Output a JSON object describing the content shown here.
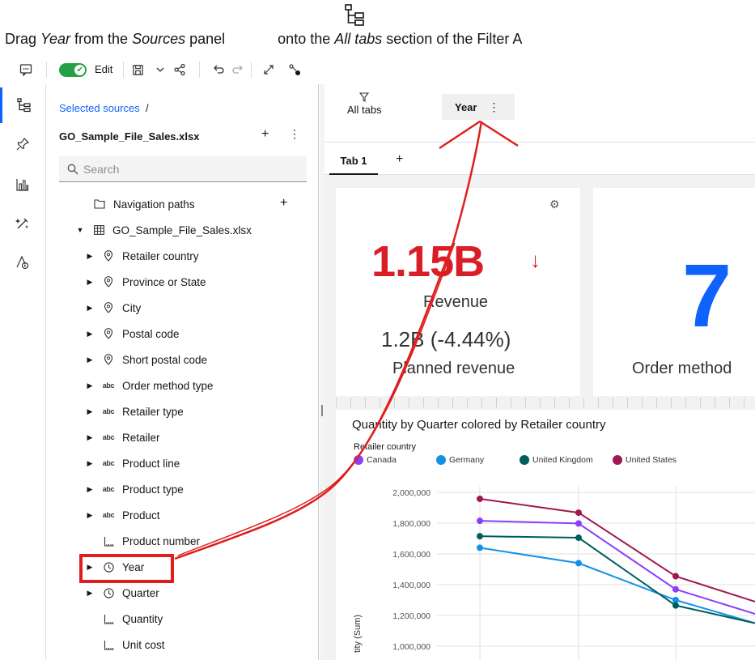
{
  "instruction": {
    "prefix": "Drag ",
    "em1": "Year",
    "mid": " from the ",
    "em2": "Sources",
    "after": " panel",
    "rest": " onto the ",
    "em3": "All tabs",
    "end": " section of the Filter A"
  },
  "toolbar": {
    "edit_label": "Edit",
    "edit_on": true
  },
  "sources": {
    "breadcrumb": "Selected sources",
    "breadcrumb_sep": "/",
    "file_title": "GO_Sample_File_Sales.xlsx",
    "search_placeholder": "Search",
    "navigation_paths": "Navigation paths",
    "file_node": "GO_Sample_File_Sales.xlsx",
    "items": [
      {
        "label": "Retailer country",
        "icon": "location-icon",
        "expandable": true
      },
      {
        "label": "Province or State",
        "icon": "location-icon",
        "expandable": true
      },
      {
        "label": "City",
        "icon": "location-icon",
        "expandable": true
      },
      {
        "label": "Postal code",
        "icon": "location-icon",
        "expandable": true
      },
      {
        "label": "Short postal code",
        "icon": "location-icon",
        "expandable": true
      },
      {
        "label": "Order method type",
        "icon": "text-icon",
        "expandable": true
      },
      {
        "label": "Retailer type",
        "icon": "text-icon",
        "expandable": true
      },
      {
        "label": "Retailer",
        "icon": "text-icon",
        "expandable": true
      },
      {
        "label": "Product line",
        "icon": "text-icon",
        "expandable": true
      },
      {
        "label": "Product type",
        "icon": "text-icon",
        "expandable": true
      },
      {
        "label": "Product",
        "icon": "text-icon",
        "expandable": true
      },
      {
        "label": "Product number",
        "icon": "measure-icon",
        "expandable": false
      },
      {
        "label": "Year",
        "icon": "clock-icon",
        "expandable": true
      },
      {
        "label": "Quarter",
        "icon": "clock-icon",
        "expandable": true
      },
      {
        "label": "Quantity",
        "icon": "measure-icon",
        "expandable": false
      },
      {
        "label": "Unit cost",
        "icon": "measure-icon",
        "expandable": false
      }
    ]
  },
  "filters": {
    "all_tabs_label": "All tabs",
    "chip_label": "Year"
  },
  "tabs": {
    "tab1": "Tab 1",
    "add": "+"
  },
  "kpi1": {
    "value": "1.15B",
    "label": "Revenue",
    "planned": "1.2B (-4.44%)",
    "planned_label": "Planned revenue"
  },
  "kpi2": {
    "value": "7",
    "label": "Order method"
  },
  "chart": {
    "title": "Quantity by Quarter colored by Retailer country",
    "legend_title": "Retailer country",
    "ylabel": "tity (Sum)"
  },
  "chart_data": {
    "type": "line",
    "title": "Quantity by Quarter colored by Retailer country",
    "xlabel": "",
    "ylabel": "Quantity (Sum)",
    "ylim": [
      1000000,
      2000000
    ],
    "yticks": [
      2000000,
      1800000,
      1600000,
      1400000,
      1200000,
      1000000
    ],
    "ytick_labels": [
      "2,000,000",
      "1,800,000",
      "1,600,000",
      "1,400,000",
      "1,200,000",
      "1,000,000"
    ],
    "x": [
      1,
      2,
      3,
      4
    ],
    "legend_position": "top-left",
    "series": [
      {
        "name": "Canada",
        "color": "#8a3ffc",
        "values": [
          1815000,
          1798000,
          1370000,
          1210000
        ]
      },
      {
        "name": "Germany",
        "color": "#1192e8",
        "values": [
          1640000,
          1540000,
          1300000,
          1150000
        ]
      },
      {
        "name": "United Kingdom",
        "color": "#005d5d",
        "values": [
          1715000,
          1705000,
          1265000,
          1150000
        ]
      },
      {
        "name": "United States",
        "color": "#9f1853",
        "values": [
          1958000,
          1868000,
          1455000,
          1290000
        ]
      }
    ]
  }
}
